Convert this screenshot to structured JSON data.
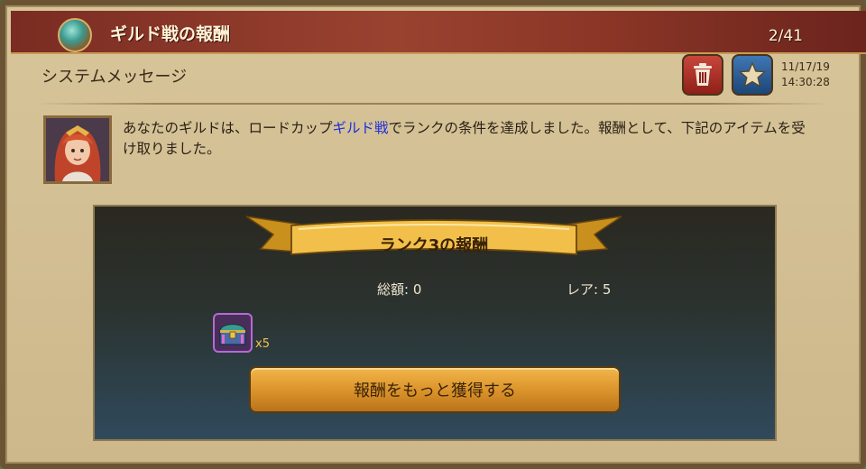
{
  "window": {
    "title": "ギルド戦の報酬",
    "page_counter": "2/41"
  },
  "mail": {
    "subject": "システムメッセージ",
    "date": "11/17/19",
    "time": "14:30:28",
    "body_before": "あなたのギルドは、ロードカップ",
    "body_highlight": "ギルド戦",
    "body_after": "でランクの条件を達成しました。報酬として、下記のアイテムを受け取りました。"
  },
  "reward": {
    "banner": "ランク3の報酬",
    "total_label": "総額: 0",
    "rare_label": "レア: 5",
    "items": [
      {
        "icon": "treasure-chest-icon",
        "quantity": "x5"
      }
    ],
    "claim_button": "報酬をもっと獲得する"
  },
  "colors": {
    "highlight": "#1f2fd8",
    "title_bar": "#8a3526",
    "button": "#d9922a"
  }
}
